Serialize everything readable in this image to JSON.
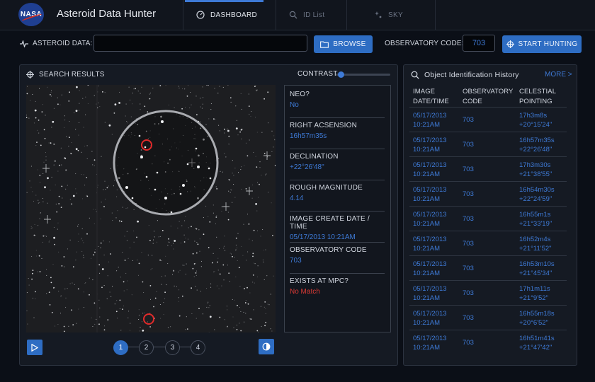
{
  "header": {
    "logo_text": "NASA",
    "app_title": "Asteroid Data Hunter",
    "tabs": [
      {
        "label": "DASHBOARD",
        "icon": "dashboard-icon",
        "active": true
      },
      {
        "label": "ID List",
        "icon": "search-icon",
        "active": false
      },
      {
        "label": "SKY",
        "icon": "sky-icon",
        "active": false
      }
    ]
  },
  "datarow": {
    "asteroid_label": "ASTEROID DATA:",
    "asteroid_value": "",
    "browse_label": "BROWSE",
    "observatory_label": "OBSERVATORY CODE:",
    "observatory_value": "703",
    "start_label": "START HUNTING"
  },
  "search": {
    "title": "SEARCH RESULTS",
    "contrast_label": "CONTRAST",
    "contrast_value": 0.05,
    "fields": [
      {
        "key": "NEO?",
        "value": "No",
        "status": "normal"
      },
      {
        "key": "RIGHT ACSENSION",
        "value": "16h57m35s",
        "status": "normal"
      },
      {
        "key": "DECLINATION",
        "value": "+22°26'48\"",
        "status": "normal"
      },
      {
        "key": "ROUGH MAGNITUDE",
        "value": "4.14",
        "status": "normal"
      },
      {
        "key": "IMAGE CREATE DATE / TIME",
        "value": "05/17/2013 10:21AM",
        "status": "normal"
      },
      {
        "key": "OBSERVATORY CODE",
        "value": "703",
        "status": "normal"
      },
      {
        "key": "EXISTS AT MPC?",
        "value": "No Match",
        "status": "alert"
      }
    ],
    "pages": [
      "1",
      "2",
      "3",
      "4"
    ],
    "active_page": "1"
  },
  "history": {
    "title": "Object Identification History",
    "more_label": "MORE >",
    "columns": [
      "IMAGE DATE/TIME",
      "OBSERVATORY CODE",
      "CELESTIAL POINTING"
    ],
    "rows": [
      {
        "date": "05/17/2013",
        "time": "10:21AM",
        "code": "703",
        "ra": "17h3m8s",
        "dec": "+20°15'24\""
      },
      {
        "date": "05/17/2013",
        "time": "10:21AM",
        "code": "703",
        "ra": "16h57m35s",
        "dec": "+22°26'48\""
      },
      {
        "date": "05/17/2013",
        "time": "10:21AM",
        "code": "703",
        "ra": "17h3m30s",
        "dec": "+21°38'55\""
      },
      {
        "date": "05/17/2013",
        "time": "10:21AM",
        "code": "703",
        "ra": "16h54m30s",
        "dec": "+22°24'59\""
      },
      {
        "date": "05/17/2013",
        "time": "10:21AM",
        "code": "703",
        "ra": "16h55m1s",
        "dec": "+21°33'19\""
      },
      {
        "date": "05/17/2013",
        "time": "10:21AM",
        "code": "703",
        "ra": "16h52m4s",
        "dec": "+21°11'52\""
      },
      {
        "date": "05/17/2013",
        "time": "10:21AM",
        "code": "703",
        "ra": "16h53m10s",
        "dec": "+21°45'34\""
      },
      {
        "date": "05/17/2013",
        "time": "10:21AM",
        "code": "703",
        "ra": "17h1m11s",
        "dec": "+21°9'52\""
      },
      {
        "date": "05/17/2013",
        "time": "10:21AM",
        "code": "703",
        "ra": "16h55m18s",
        "dec": "+20°6'52\""
      },
      {
        "date": "05/17/2013",
        "time": "10:21AM",
        "code": "703",
        "ra": "16h51m41s",
        "dec": "+21°47'42\""
      }
    ]
  },
  "colors": {
    "accent": "#2e6dc3",
    "link": "#3e7ad6",
    "alert": "#d93a35",
    "background": "#0b0f17",
    "panel": "#151a23"
  }
}
